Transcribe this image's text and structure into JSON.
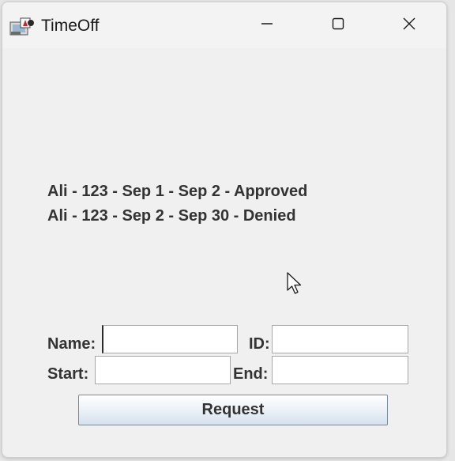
{
  "window": {
    "title": "TimeOff",
    "icon": "java-app-icon",
    "controls": [
      "minimize-icon",
      "maximize-icon",
      "close-icon"
    ]
  },
  "requests": [
    {
      "text": "Ali - 123 - Sep 1 - Sep 2 - Approved"
    },
    {
      "text": "Ali - 123 - Sep 2 - Sep 30 - Denied"
    }
  ],
  "form": {
    "name_label": "Name:",
    "name_value": "",
    "id_label": "ID:",
    "id_value": "",
    "start_label": "Start:",
    "start_value": "",
    "end_label": "End:",
    "end_value": "",
    "request_label": "Request"
  }
}
